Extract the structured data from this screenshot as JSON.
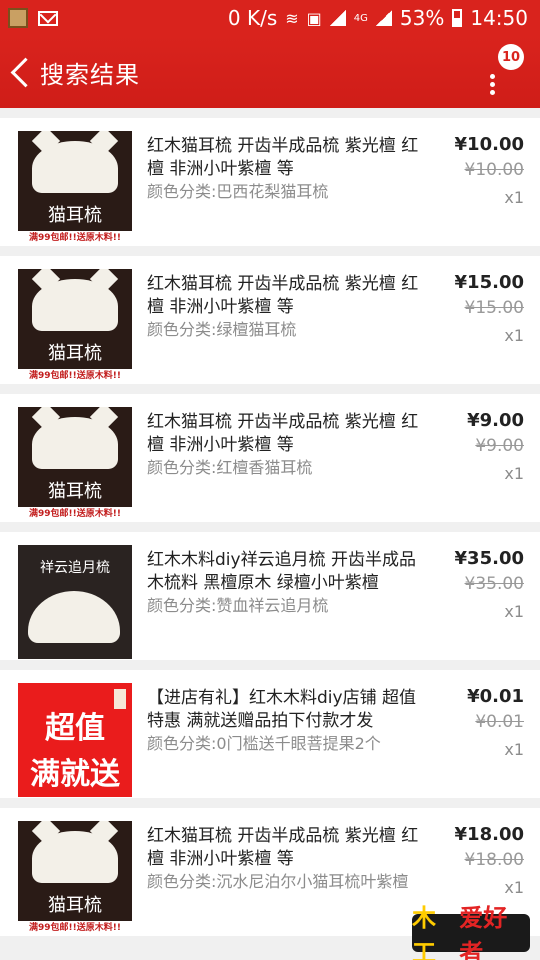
{
  "status_bar": {
    "net_speed": "0 K/s",
    "lte_label": "4G",
    "battery": "53%",
    "time": "14:50"
  },
  "header": {
    "title": "搜索结果",
    "badge": "10"
  },
  "items": [
    {
      "title": "红木猫耳梳 开齿半成品梳 紫光檀 红檀 非洲小叶紫檀 等",
      "variant": "颜色分类:巴西花梨猫耳梳",
      "price": "¥10.00",
      "orig_price": "¥10.00",
      "qty": "x1",
      "thumb": {
        "type": "comb",
        "caption": "猫耳梳",
        "strip": "满99包邮!!送原木料!!"
      }
    },
    {
      "title": "红木猫耳梳 开齿半成品梳 紫光檀 红檀 非洲小叶紫檀 等",
      "variant": "颜色分类:绿檀猫耳梳",
      "price": "¥15.00",
      "orig_price": "¥15.00",
      "qty": "x1",
      "thumb": {
        "type": "comb",
        "caption": "猫耳梳",
        "strip": "满99包邮!!送原木料!!"
      }
    },
    {
      "title": "红木猫耳梳 开齿半成品梳 紫光檀 红檀 非洲小叶紫檀 等",
      "variant": "颜色分类:红檀香猫耳梳",
      "price": "¥9.00",
      "orig_price": "¥9.00",
      "qty": "x1",
      "thumb": {
        "type": "comb",
        "caption": "猫耳梳",
        "strip": "满99包邮!!送原木料!!"
      }
    },
    {
      "title": "红木木料diy祥云追月梳 开齿半成品木梳料 黑檀原木 绿檀小叶紫檀",
      "variant": "颜色分类:赞血祥云追月梳",
      "price": "¥35.00",
      "orig_price": "¥35.00",
      "qty": "x1",
      "thumb": {
        "type": "moon",
        "caption": "祥云追月梳"
      }
    },
    {
      "title": "【进店有礼】红木木料diy店铺 超值特惠 满就送赠品拍下付款才发",
      "variant": "颜色分类:0门槛送千眼菩提果2个",
      "price": "¥0.01",
      "orig_price": "¥0.01",
      "qty": "x1",
      "thumb": {
        "type": "promo",
        "line1": "超值",
        "line2": "满就送"
      }
    },
    {
      "title": "红木猫耳梳 开齿半成品梳 紫光檀 红檀 非洲小叶紫檀 等",
      "variant": "颜色分类:沉水尼泊尔小猫耳梳叶紫檀",
      "price": "¥18.00",
      "orig_price": "¥18.00",
      "qty": "x1",
      "thumb": {
        "type": "comb",
        "caption": "猫耳梳",
        "strip": "满99包邮!!送原木料!!"
      }
    }
  ],
  "watermark": {
    "left": "木工",
    "right": "爱好者"
  }
}
